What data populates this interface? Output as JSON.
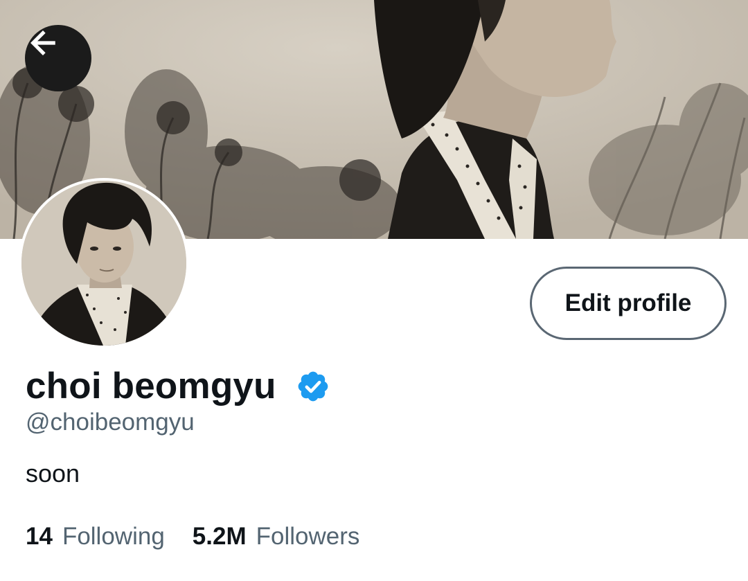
{
  "profile": {
    "display_name": "choi beomgyu",
    "handle": "@choibeomgyu",
    "bio": "soon",
    "verified": true,
    "edit_button_label": "Edit profile"
  },
  "stats": {
    "following_count": "14",
    "following_label": "Following",
    "followers_count": "5.2M",
    "followers_label": "Followers"
  },
  "icons": {
    "back": "arrow-left-icon",
    "verified": "verified-badge-icon"
  },
  "colors": {
    "verified_blue": "#1d9bf0",
    "secondary_text": "#536471",
    "primary_text": "#0f1419"
  }
}
